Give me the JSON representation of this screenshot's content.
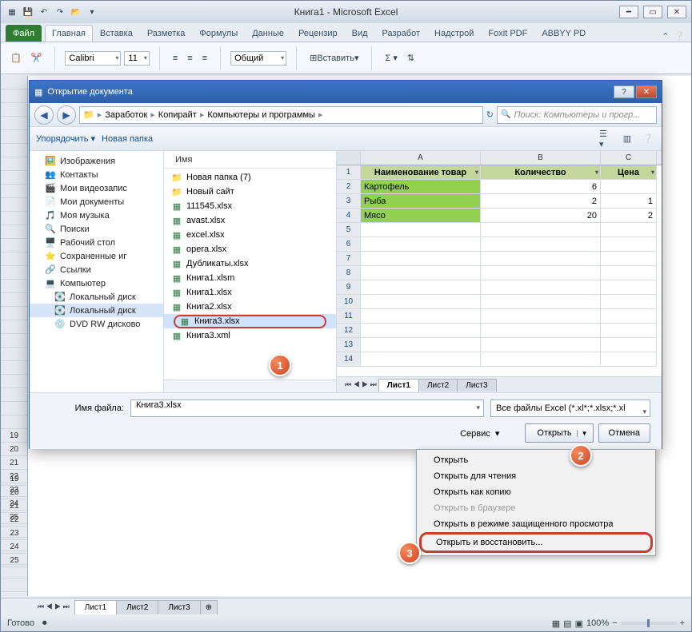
{
  "app": {
    "title": "Книга1  -  Microsoft Excel"
  },
  "ribbon": {
    "file": "Файл",
    "tabs": [
      "Главная",
      "Вставка",
      "Разметка",
      "Формулы",
      "Данные",
      "Рецензир",
      "Вид",
      "Разработ",
      "Надстрой",
      "Foxit PDF",
      "ABBYY PD"
    ],
    "font": "Calibri",
    "size": "11",
    "numfmt": "Общий",
    "paste": "Вставить"
  },
  "dialog": {
    "title": "Открытие документа",
    "crumbs": [
      "Заработок",
      "Копирайт",
      "Компьютеры и программы"
    ],
    "search_ph": "Поиск: Компьютеры и прогр...",
    "toolbar": {
      "organize": "Упорядочить",
      "newfolder": "Новая папка"
    },
    "tree": [
      {
        "ico": "🖼️",
        "label": "Изображения"
      },
      {
        "ico": "👥",
        "label": "Контакты"
      },
      {
        "ico": "🎬",
        "label": "Мои видеозапис"
      },
      {
        "ico": "📄",
        "label": "Мои документы"
      },
      {
        "ico": "🎵",
        "label": "Моя музыка"
      },
      {
        "ico": "🔍",
        "label": "Поиски"
      },
      {
        "ico": "🖥️",
        "label": "Рабочий стол"
      },
      {
        "ico": "⭐",
        "label": "Сохраненные иг"
      },
      {
        "ico": "🔗",
        "label": "Ссылки"
      },
      {
        "ico": "💻",
        "label": "Компьютер",
        "root": true
      },
      {
        "ico": "💽",
        "label": "Локальный диск",
        "indent": true
      },
      {
        "ico": "💽",
        "label": "Локальный диск",
        "indent": true,
        "sel": true
      },
      {
        "ico": "💿",
        "label": "DVD RW дисково",
        "indent": true
      }
    ],
    "filehead": "Имя",
    "files": [
      {
        "type": "folder",
        "label": "Новая папка (7)"
      },
      {
        "type": "folder",
        "label": "Новый сайт"
      },
      {
        "type": "xl",
        "label": "111545.xlsx"
      },
      {
        "type": "xl",
        "label": "avast.xlsx"
      },
      {
        "type": "xl",
        "label": "excel.xlsx"
      },
      {
        "type": "xl",
        "label": "opera.xlsx"
      },
      {
        "type": "xl",
        "label": "Дубликаты.xlsx"
      },
      {
        "type": "xl",
        "label": "Книга1.xlsm"
      },
      {
        "type": "xl",
        "label": "Книга1.xlsx"
      },
      {
        "type": "xl",
        "label": "Книга2.xlsx"
      },
      {
        "type": "xl",
        "label": "Книга3.xlsx",
        "sel": true
      },
      {
        "type": "xl",
        "label": "Книга3.xml"
      }
    ],
    "filename_label": "Имя файла:",
    "filename": "Книга3.xlsx",
    "filetype": "Все файлы Excel (*.xl*;*.xlsx;*.xl",
    "tools": "Сервис",
    "open": "Открыть",
    "cancel": "Отмена"
  },
  "preview": {
    "cols": [
      "A",
      "B",
      "C"
    ],
    "header": [
      "Наименование товар",
      "Количество",
      "Цена"
    ],
    "rows": [
      {
        "n": 2,
        "a": "Картофель",
        "b": "6",
        "c": ""
      },
      {
        "n": 3,
        "a": "Рыба",
        "b": "2",
        "c": "1"
      },
      {
        "n": 4,
        "a": "Мясо",
        "b": "20",
        "c": "2"
      }
    ],
    "blank": [
      5,
      6,
      7,
      8,
      9,
      10,
      11,
      12,
      13,
      14
    ],
    "tabs": [
      "Лист1",
      "Лист2",
      "Лист3"
    ]
  },
  "menu": {
    "items": [
      {
        "label": "Открыть"
      },
      {
        "label": "Открыть для чтения"
      },
      {
        "label": "Открыть как копию"
      },
      {
        "label": "Открыть в браузере",
        "disabled": true
      },
      {
        "label": "Открыть в режиме защищенного просмотра"
      },
      {
        "label": "Открыть и восстановить...",
        "callout": true
      }
    ]
  },
  "sheets": {
    "tabs": [
      "Лист1",
      "Лист2",
      "Лист3"
    ]
  },
  "status": {
    "ready": "Готово",
    "zoom": "100%"
  },
  "badges": {
    "b1": "1",
    "b2": "2",
    "b3": "3"
  },
  "grid_rows": [
    19,
    20,
    21,
    22,
    23,
    24,
    25
  ]
}
